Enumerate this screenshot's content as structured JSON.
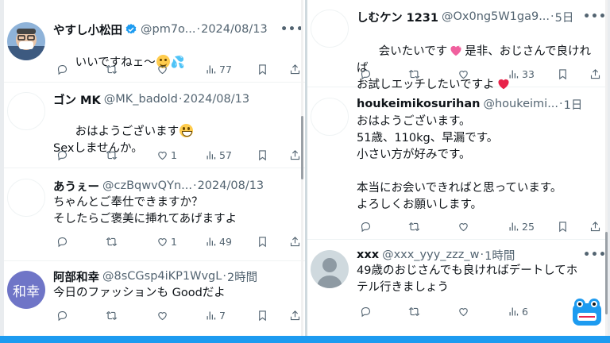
{
  "left_column": {
    "tweets": [
      {
        "name": "やすし小松田",
        "verified": true,
        "handle": "@pm7o...",
        "time": "2024/08/13",
        "text_before": "いいですねェ〜",
        "text_after": "💦",
        "emoji": "smile",
        "avatar": "photo",
        "replies": "",
        "retweets": "",
        "likes": "",
        "views": "77"
      },
      {
        "name": "ゴン MK",
        "handle": "@MK_badold",
        "time": "2024/08/13",
        "text_line1": "おはようございます",
        "text_line2": "Sexしませんか。",
        "emoji": "grin",
        "avatar": "empty",
        "replies": "",
        "retweets": "",
        "likes": "1",
        "views": "57"
      },
      {
        "name": "あうぇー",
        "handle": "@czBqwvQYn...",
        "time": "2024/08/13",
        "text": "ちゃんとご奉仕できますか？\nそしたらご褒美に挿れてあげますよ",
        "avatar": "empty",
        "replies": "",
        "retweets": "",
        "likes": "1",
        "views": "49"
      },
      {
        "name": "阿部和幸",
        "handle": "@8sCGsp4iKP1WvgL",
        "time": "2時間",
        "text": "今日のファッションも Goodだよ",
        "avatar": "initials",
        "avatar_text": "和幸",
        "replies": "",
        "retweets": "",
        "likes": "",
        "views": "7"
      }
    ]
  },
  "right_column": {
    "tweets": [
      {
        "name": "しむケン 1231",
        "handle": "@Ox0ng5W1ga9...",
        "time": "5日",
        "text_line1_a": "会いたいです",
        "text_line1_b": "是非、おじさんで良ければ",
        "text_line2": "お試しエッチしたいですよ",
        "avatar": "empty",
        "replies": "",
        "retweets": "",
        "likes": "",
        "views": "33"
      },
      {
        "name": "houkeimikosurihan",
        "handle": "@houkeimi...",
        "time": "1日",
        "text": "おはようございます。\n51歳、110kg、早漏です。\n小さい方が好みです。\n\n本当にお会いできればと思っています。\nよろしくお願いします。",
        "avatar": "empty",
        "replies": "",
        "retweets": "",
        "likes": "",
        "views": "25"
      },
      {
        "name": "xxx",
        "handle": "@xxx_yyy_zzz_w",
        "time": "1時間",
        "text": "49歳のおじさんでも良ければデートしてホ\nテル行きましょう",
        "avatar": "default",
        "replies": "",
        "retweets": "",
        "likes": "",
        "views": "6"
      }
    ]
  },
  "ui": {
    "separator": "·",
    "more_label": "•••"
  },
  "colors": {
    "accent": "#1d9bf0",
    "text_primary": "#0f1419",
    "text_secondary": "#536471",
    "divider": "#cfd9de",
    "avatar_initials_bg": "#6f75c7",
    "heart": "#e8234a",
    "kiss_heart": "#f0609e"
  },
  "icons": [
    "reply-icon",
    "retweet-icon",
    "like-icon",
    "views-icon",
    "bookmark-icon",
    "share-icon",
    "verified-badge-icon",
    "more-options-icon"
  ]
}
